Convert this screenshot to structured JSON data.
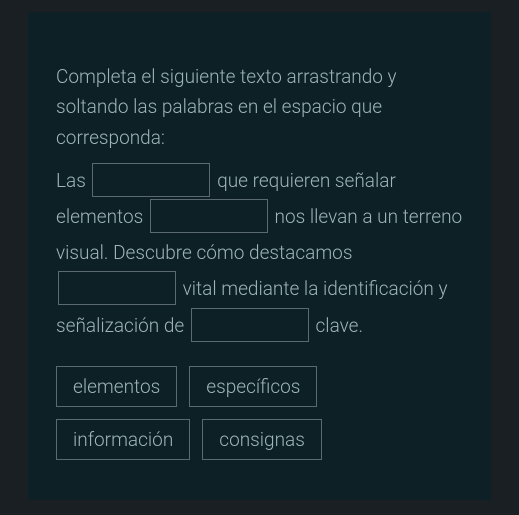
{
  "instructions": "Completa el siguiente texto arrastrando y soltando las palabras en el espacio que corresponda:",
  "text": {
    "seg1": "Las ",
    "seg2": " que requieren señalar elementos ",
    "seg3": " nos llevan a un terreno visual. Descubre cómo destacamos ",
    "seg4": "  vital mediante la identificación y señalización de ",
    "seg5": " clave."
  },
  "wordbank": {
    "w1": "elementos",
    "w2": "específicos",
    "w3": "información",
    "w4": "consignas"
  }
}
